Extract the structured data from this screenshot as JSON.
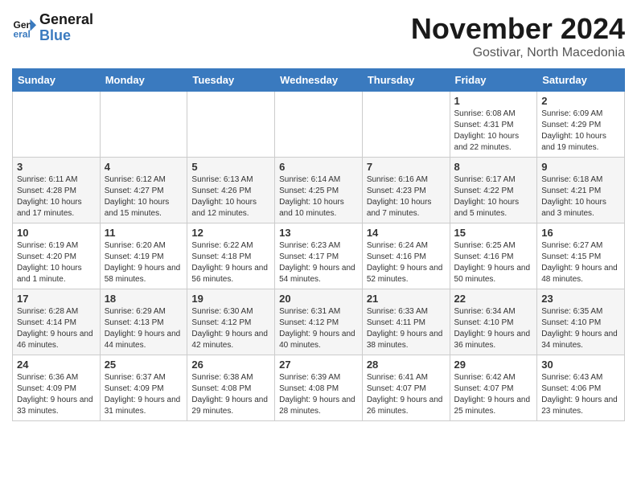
{
  "header": {
    "logo_line1": "General",
    "logo_line2": "Blue",
    "month": "November 2024",
    "location": "Gostivar, North Macedonia"
  },
  "weekdays": [
    "Sunday",
    "Monday",
    "Tuesday",
    "Wednesday",
    "Thursday",
    "Friday",
    "Saturday"
  ],
  "weeks": [
    [
      {
        "day": "",
        "info": ""
      },
      {
        "day": "",
        "info": ""
      },
      {
        "day": "",
        "info": ""
      },
      {
        "day": "",
        "info": ""
      },
      {
        "day": "",
        "info": ""
      },
      {
        "day": "1",
        "sunrise": "6:08 AM",
        "sunset": "4:31 PM",
        "daylight": "10 hours and 22 minutes."
      },
      {
        "day": "2",
        "sunrise": "6:09 AM",
        "sunset": "4:29 PM",
        "daylight": "10 hours and 19 minutes."
      }
    ],
    [
      {
        "day": "3",
        "sunrise": "6:11 AM",
        "sunset": "4:28 PM",
        "daylight": "10 hours and 17 minutes."
      },
      {
        "day": "4",
        "sunrise": "6:12 AM",
        "sunset": "4:27 PM",
        "daylight": "10 hours and 15 minutes."
      },
      {
        "day": "5",
        "sunrise": "6:13 AM",
        "sunset": "4:26 PM",
        "daylight": "10 hours and 12 minutes."
      },
      {
        "day": "6",
        "sunrise": "6:14 AM",
        "sunset": "4:25 PM",
        "daylight": "10 hours and 10 minutes."
      },
      {
        "day": "7",
        "sunrise": "6:16 AM",
        "sunset": "4:23 PM",
        "daylight": "10 hours and 7 minutes."
      },
      {
        "day": "8",
        "sunrise": "6:17 AM",
        "sunset": "4:22 PM",
        "daylight": "10 hours and 5 minutes."
      },
      {
        "day": "9",
        "sunrise": "6:18 AM",
        "sunset": "4:21 PM",
        "daylight": "10 hours and 3 minutes."
      }
    ],
    [
      {
        "day": "10",
        "sunrise": "6:19 AM",
        "sunset": "4:20 PM",
        "daylight": "10 hours and 1 minute."
      },
      {
        "day": "11",
        "sunrise": "6:20 AM",
        "sunset": "4:19 PM",
        "daylight": "9 hours and 58 minutes."
      },
      {
        "day": "12",
        "sunrise": "6:22 AM",
        "sunset": "4:18 PM",
        "daylight": "9 hours and 56 minutes."
      },
      {
        "day": "13",
        "sunrise": "6:23 AM",
        "sunset": "4:17 PM",
        "daylight": "9 hours and 54 minutes."
      },
      {
        "day": "14",
        "sunrise": "6:24 AM",
        "sunset": "4:16 PM",
        "daylight": "9 hours and 52 minutes."
      },
      {
        "day": "15",
        "sunrise": "6:25 AM",
        "sunset": "4:16 PM",
        "daylight": "9 hours and 50 minutes."
      },
      {
        "day": "16",
        "sunrise": "6:27 AM",
        "sunset": "4:15 PM",
        "daylight": "9 hours and 48 minutes."
      }
    ],
    [
      {
        "day": "17",
        "sunrise": "6:28 AM",
        "sunset": "4:14 PM",
        "daylight": "9 hours and 46 minutes."
      },
      {
        "day": "18",
        "sunrise": "6:29 AM",
        "sunset": "4:13 PM",
        "daylight": "9 hours and 44 minutes."
      },
      {
        "day": "19",
        "sunrise": "6:30 AM",
        "sunset": "4:12 PM",
        "daylight": "9 hours and 42 minutes."
      },
      {
        "day": "20",
        "sunrise": "6:31 AM",
        "sunset": "4:12 PM",
        "daylight": "9 hours and 40 minutes."
      },
      {
        "day": "21",
        "sunrise": "6:33 AM",
        "sunset": "4:11 PM",
        "daylight": "9 hours and 38 minutes."
      },
      {
        "day": "22",
        "sunrise": "6:34 AM",
        "sunset": "4:10 PM",
        "daylight": "9 hours and 36 minutes."
      },
      {
        "day": "23",
        "sunrise": "6:35 AM",
        "sunset": "4:10 PM",
        "daylight": "9 hours and 34 minutes."
      }
    ],
    [
      {
        "day": "24",
        "sunrise": "6:36 AM",
        "sunset": "4:09 PM",
        "daylight": "9 hours and 33 minutes."
      },
      {
        "day": "25",
        "sunrise": "6:37 AM",
        "sunset": "4:09 PM",
        "daylight": "9 hours and 31 minutes."
      },
      {
        "day": "26",
        "sunrise": "6:38 AM",
        "sunset": "4:08 PM",
        "daylight": "9 hours and 29 minutes."
      },
      {
        "day": "27",
        "sunrise": "6:39 AM",
        "sunset": "4:08 PM",
        "daylight": "9 hours and 28 minutes."
      },
      {
        "day": "28",
        "sunrise": "6:41 AM",
        "sunset": "4:07 PM",
        "daylight": "9 hours and 26 minutes."
      },
      {
        "day": "29",
        "sunrise": "6:42 AM",
        "sunset": "4:07 PM",
        "daylight": "9 hours and 25 minutes."
      },
      {
        "day": "30",
        "sunrise": "6:43 AM",
        "sunset": "4:06 PM",
        "daylight": "9 hours and 23 minutes."
      }
    ]
  ],
  "labels": {
    "sunrise": "Sunrise:",
    "sunset": "Sunset:",
    "daylight": "Daylight:"
  }
}
